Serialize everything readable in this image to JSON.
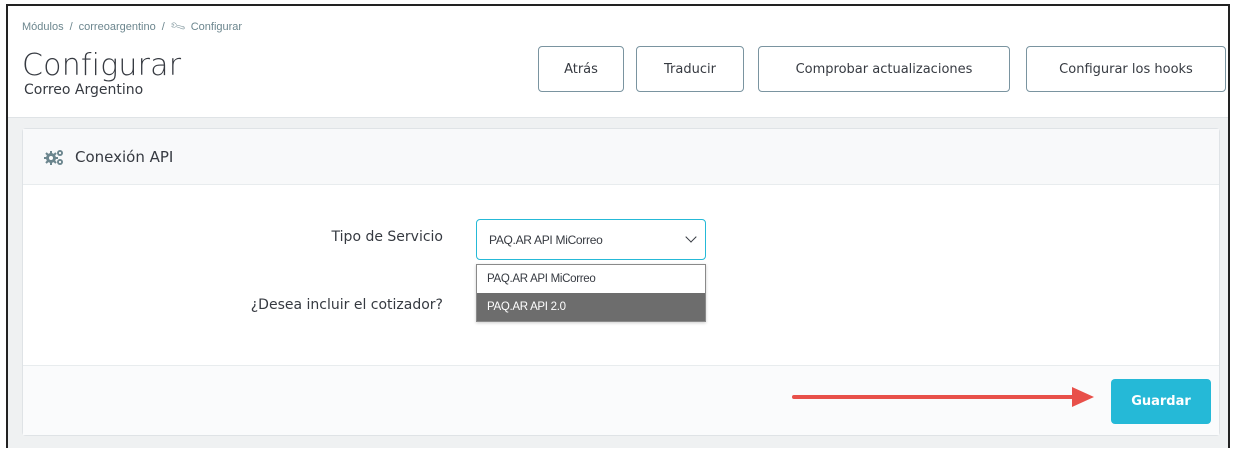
{
  "breadcrumb": {
    "items": [
      "Módulos",
      "correoargentino",
      "Configurar"
    ],
    "separator": "/"
  },
  "header": {
    "title": "Configurar",
    "subtitle": "Correo Argentino"
  },
  "toolbar": {
    "back_label": "Atrás",
    "translate_label": "Traducir",
    "updates_label": "Comprobar actualizaciones",
    "hooks_label": "Configurar los hooks"
  },
  "panel": {
    "title": "Conexión API",
    "icon": "cogs-icon"
  },
  "form": {
    "service_type_label": "Tipo de Servicio",
    "service_type_value": "PAQ.AR API MiCorreo",
    "quote_label": "¿Desea incluir el cotizador?",
    "service_options": [
      "PAQ.AR API MiCorreo",
      "PAQ.AR API 2.0"
    ],
    "highlighted_option_index": 1
  },
  "footer": {
    "save_label": "Guardar"
  },
  "colors": {
    "accent": "#25b9d7",
    "annotation_arrow": "#e8504a",
    "dropdown_highlight": "#6d6d6d"
  }
}
